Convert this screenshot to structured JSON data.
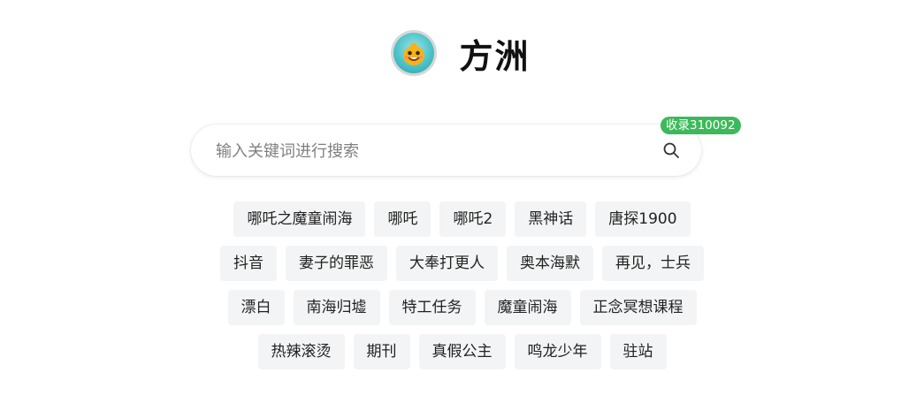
{
  "brand": {
    "name": "方洲",
    "logo_icon": "mascot-logo-icon"
  },
  "search": {
    "placeholder": "输入关键词进行搜索",
    "value": "",
    "icon": "search-icon",
    "badge": "收录310092",
    "badge_color": "#3cb95a"
  },
  "hot_tags": {
    "rows": [
      [
        "哪吒之魔童闹海",
        "哪吒",
        "哪吒2",
        "黑神话",
        "唐探1900"
      ],
      [
        "抖音",
        "妻子的罪恶",
        "大奉打更人",
        "奥本海默",
        "再见，士兵"
      ],
      [
        "漂白",
        "南海归墟",
        "特工任务",
        "魔童闹海",
        "正念冥想课程"
      ],
      [
        "热辣滚烫",
        "期刊",
        "真假公主",
        "鸣龙少年",
        "驻站"
      ]
    ]
  }
}
